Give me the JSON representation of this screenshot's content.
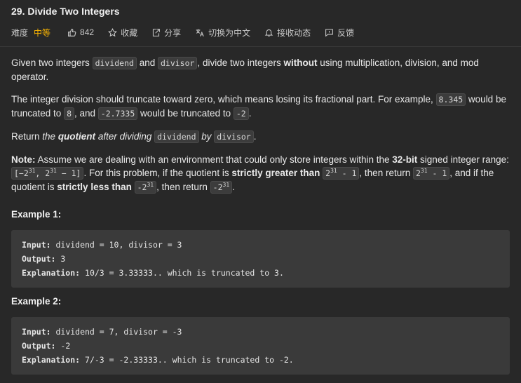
{
  "problem": {
    "title": "29. Divide Two Integers"
  },
  "meta": {
    "difficulty_label": "难度",
    "difficulty": "中等",
    "likes": "842",
    "favorite": "收藏",
    "share": "分享",
    "switch_lang": "切换为中文",
    "notify": "接收动态",
    "feedback": "反馈",
    "difficulty_color": "#ffb800"
  },
  "desc": {
    "p1_a": "Given two integers ",
    "p1_code1": "dividend",
    "p1_b": " and ",
    "p1_code2": "divisor",
    "p1_c": ", divide two integers ",
    "p1_bold": "without",
    "p1_d": " using multiplication, division, and mod operator.",
    "p2_a": "The integer division should truncate toward zero, which means losing its fractional part. For example, ",
    "p2_code1": "8.345",
    "p2_b": " would be truncated to ",
    "p2_code2": "8",
    "p2_c": ", and ",
    "p2_code3": "-2.7335",
    "p2_d": " would be truncated to ",
    "p2_code4": "-2",
    "p2_e": ".",
    "p3_a": "Return ",
    "p3_i1": "the ",
    "p3_bi": "quotient",
    "p3_i2": " after dividing ",
    "p3_code1": "dividend",
    "p3_i3": " by ",
    "p3_code2": "divisor",
    "p3_e": ".",
    "p4_note": "Note:",
    "p4_a": " Assume we are dealing with an environment that could only store integers within the ",
    "p4_bold1": "32-bit",
    "p4_b": " signed integer range:",
    "p4_range_a": "[−2",
    "p4_range_exp1": "31",
    "p4_range_b": ", 2",
    "p4_range_exp2": "31",
    "p4_range_c": " − 1]",
    "p4_c": ". For this problem, if the quotient is ",
    "p4_bold2": "strictly greater than",
    "p4_code2_a": "2",
    "p4_code2_exp": "31",
    "p4_code2_b": " - 1",
    "p4_d": ", then return ",
    "p4_code3_a": "2",
    "p4_code3_exp": "31",
    "p4_code3_b": " - 1",
    "p4_e": ", and if the quotient is ",
    "p4_bold3": "strictly less than",
    "p4_code4_a": "-2",
    "p4_code4_exp": "31",
    "p4_f": ", then return ",
    "p4_code5_a": "-2",
    "p4_code5_exp": "31",
    "p4_g": "."
  },
  "examples": [
    {
      "title": "Example 1:",
      "input_label": "Input:",
      "input": " dividend = 10, divisor = 3",
      "output_label": "Output:",
      "output": " 3",
      "expl_label": "Explanation:",
      "expl": " 10/3 = 3.33333.. which is truncated to 3."
    },
    {
      "title": "Example 2:",
      "input_label": "Input:",
      "input": " dividend = 7, divisor = -3",
      "output_label": "Output:",
      "output": " -2",
      "expl_label": "Explanation:",
      "expl": " 7/-3 = -2.33333.. which is truncated to -2."
    }
  ]
}
